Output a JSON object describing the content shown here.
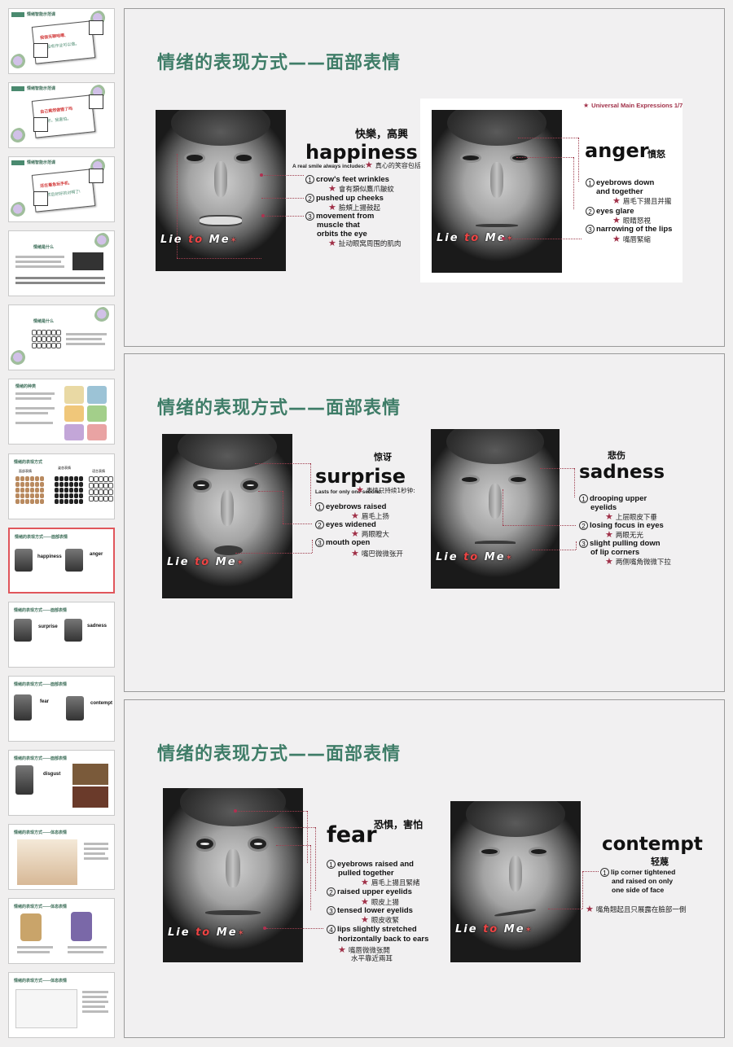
{
  "thumbnails": [
    {
      "title": "情绪智能示范课",
      "line1": "我很无聊哈嗯,",
      "line2": "我没有作业可以做。"
    },
    {
      "title": "情绪智能示范课",
      "line1": "自己竟然做错了吗",
      "line2": "我好。我害怕。"
    },
    {
      "title": "情绪智能示范课",
      "line1": "还在着急玩手机,",
      "line2": "我然后好好的对啊了!"
    },
    {
      "title": "情绪是什么"
    },
    {
      "title": "情绪是什么"
    },
    {
      "title": "情绪的种类"
    },
    {
      "title": "情绪的表现方式",
      "labels": [
        "面部表情",
        "姿态表情",
        "语言表情"
      ]
    },
    {
      "title": "情绪的表现方式——面部表情",
      "words": [
        "happiness",
        "anger"
      ]
    },
    {
      "title": "情绪的表现方式——面部表情",
      "words": [
        "surprise",
        "sadness"
      ]
    },
    {
      "title": "情绪的表现方式——面部表情",
      "words": [
        "fear",
        "contempt"
      ]
    },
    {
      "title": "情绪的表现方式——面部表情",
      "words": [
        "disgust"
      ]
    },
    {
      "title": "情绪的表现方式——体态表情"
    },
    {
      "title": "情绪的表现方式——体态表情"
    },
    {
      "title": "情绪的表现方式——体态表情"
    }
  ],
  "slides": [
    {
      "title": "情绪的表现方式——面部表情",
      "watermark": {
        "lie": "Lie",
        "to": "to",
        "me": "Me"
      },
      "left": {
        "cn_title": "快樂，高興",
        "word": "happiness",
        "note_en": "A real smile always includes:",
        "note_cn": "真心的笑容包括",
        "points": [
          {
            "num": "1",
            "en": "crow's feet wrinkles",
            "cn": "會有類似鷹爪皺紋"
          },
          {
            "num": "2",
            "en": "pushed up cheeks",
            "cn": "臉頰上揚鼓起"
          },
          {
            "num": "3",
            "en": "movement from muscle that orbits the eye",
            "en_lines": [
              "movement from",
              "muscle that",
              "orbits the eye"
            ],
            "cn": "扯动眼窝周围的肌肉"
          }
        ]
      },
      "right": {
        "header": "Universal Main Expressions 1/7",
        "word": "anger",
        "cn_title": "憤怒",
        "points": [
          {
            "num": "1",
            "en_lines": [
              "eyebrows down",
              "and together"
            ],
            "cn": "眉毛下揚且并攏"
          },
          {
            "num": "2",
            "en_lines": [
              "eyes glare"
            ],
            "cn": "眼睛怒視"
          },
          {
            "num": "3",
            "en_lines": [
              "narrowing of the lips"
            ],
            "cn": "嘴唇緊縮"
          }
        ]
      }
    },
    {
      "title": "情绪的表现方式——面部表情",
      "left": {
        "cn_title": "惊讶",
        "word": "surprise",
        "note_en": "Lasts for only one second:",
        "note_cn": "表情只持续1秒钟:",
        "points": [
          {
            "num": "1",
            "en_lines": [
              "eyebrows raised"
            ],
            "cn": "眉毛上扬"
          },
          {
            "num": "2",
            "en_lines": [
              "eyes widened"
            ],
            "cn": "两眼瞪大"
          },
          {
            "num": "3",
            "en_lines": [
              "mouth open"
            ],
            "cn": "嘴巴微微张开"
          }
        ]
      },
      "right": {
        "cn_title": "悲伤",
        "word": "sadness",
        "points": [
          {
            "num": "1",
            "en_lines": [
              "drooping upper",
              "eyelids"
            ],
            "cn": "上层眼皮下垂"
          },
          {
            "num": "2",
            "en_lines": [
              "losing focus in eyes"
            ],
            "cn": "两眼无光"
          },
          {
            "num": "3",
            "en_lines": [
              "slight pulling down",
              "of lip corners"
            ],
            "cn": "两侧嘴角微微下拉"
          }
        ]
      }
    },
    {
      "title": "情绪的表现方式——面部表情",
      "left": {
        "cn_title": "恐惧，害怕",
        "word": "fear",
        "points": [
          {
            "num": "1",
            "en_lines": [
              "eyebrows raised and",
              "pulled together"
            ],
            "cn_lines": [
              "眉毛上揚且緊緒"
            ]
          },
          {
            "num": "2",
            "en_lines": [
              "raised upper eyelids"
            ],
            "cn_lines": [
              "眼皮上揚"
            ]
          },
          {
            "num": "3",
            "en_lines": [
              "tensed lower eyelids"
            ],
            "cn_lines": [
              "眼皮收緊"
            ]
          },
          {
            "num": "4",
            "en_lines": [
              "lips slightly stretched",
              "horizontally back to ears"
            ],
            "cn_lines": [
              "嘴唇微微张開",
              "水平靠近兩耳"
            ]
          }
        ]
      },
      "right": {
        "word": "contempt",
        "cn_title": "轻蔑",
        "points": [
          {
            "num": "1",
            "en_lines": [
              "lip corner tightened",
              "and raised on only",
              "one side of face"
            ],
            "cn": "嘴角翹起且只展露在臉部一側"
          }
        ]
      }
    }
  ],
  "colors": {
    "title_green": "#3f7d68",
    "accent_red": "#a03048",
    "selected_border": "#e0565b"
  }
}
